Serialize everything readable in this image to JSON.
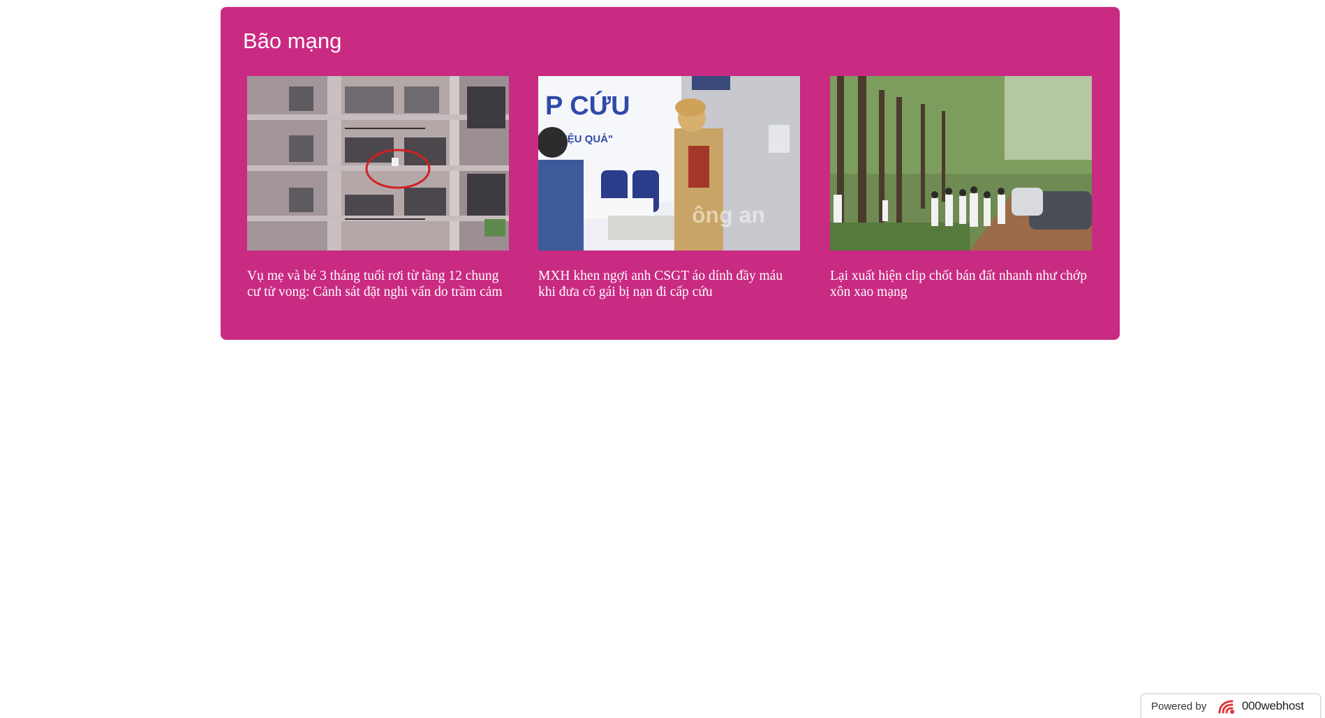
{
  "section": {
    "title": "Bão mạng",
    "background_color": "#c92a82"
  },
  "articles": [
    {
      "title": "Vụ mẹ và bé 3 tháng tuổi rơi từ tầng 12 chung cư tử vong: Cảnh sát đặt nghi vấn do trầm cảm",
      "image_alt": "apartment building with balcony circled in red"
    },
    {
      "title": "MXH khen ngợi anh CSGT áo dính đầy máu khi đưa cô gái bị nạn đi cấp cứu",
      "image_alt": "traffic police officer at hospital emergency room"
    },
    {
      "title": "Lại xuất hiện clip chốt bán đất nhanh như chớp xôn xao mạng",
      "image_alt": "crowd of people standing beside a forest road"
    }
  ],
  "footer_badge": {
    "powered_by": "Powered by",
    "brand": "000webhost",
    "logo_icon": "000webhost-logo-icon"
  }
}
